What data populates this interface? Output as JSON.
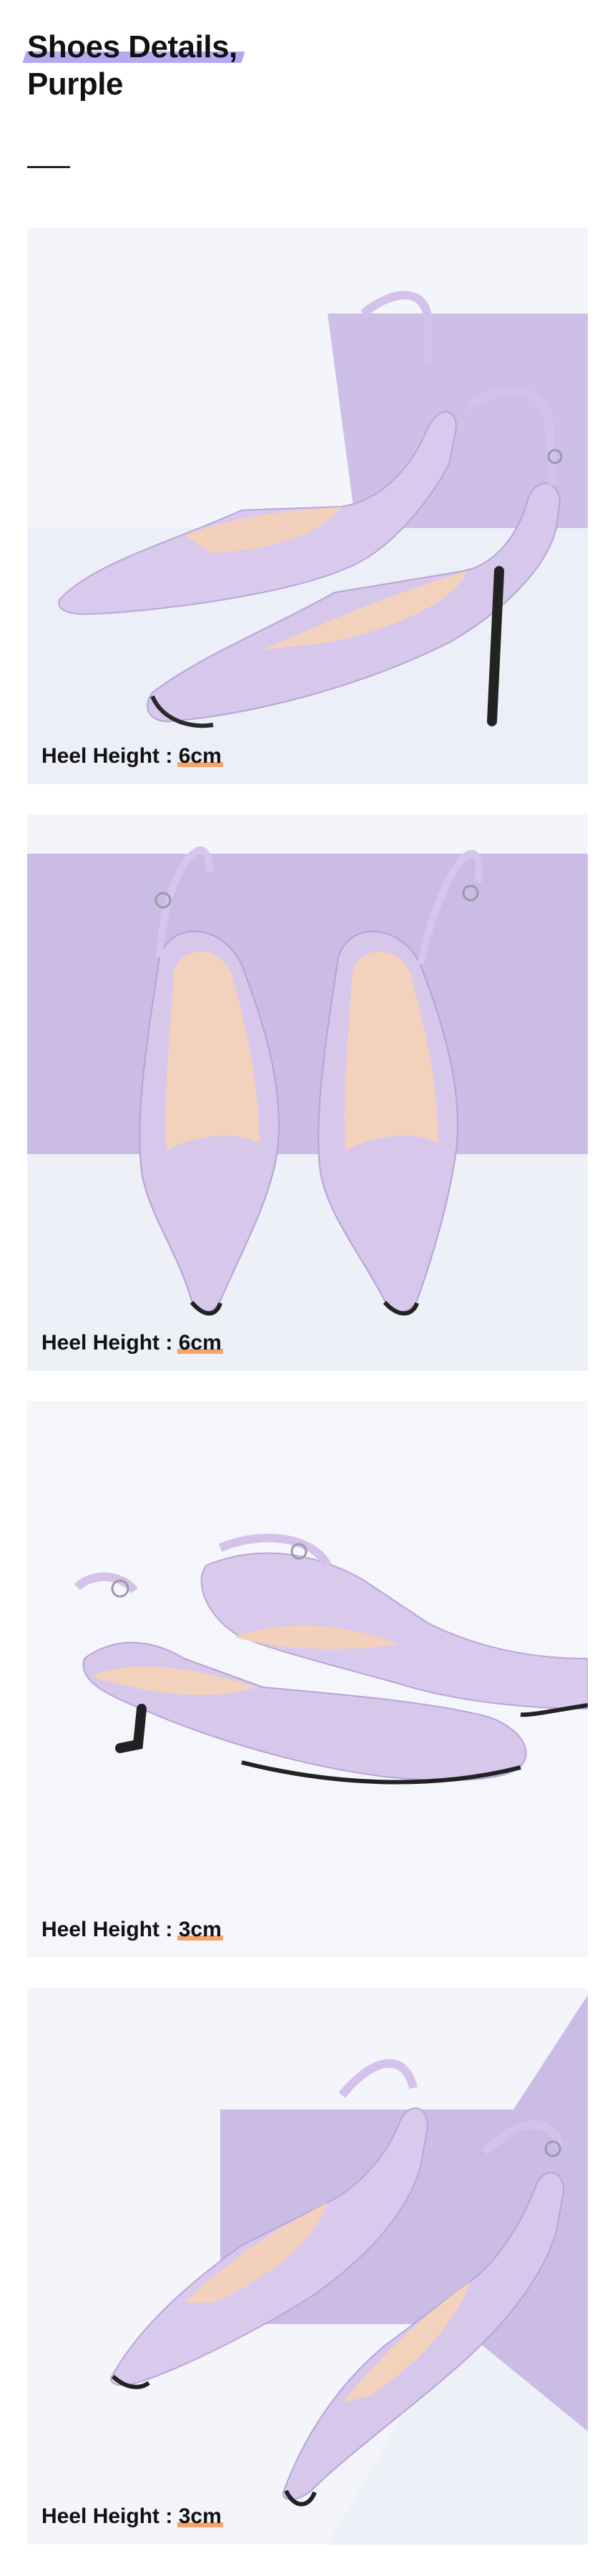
{
  "header": {
    "title_line1": "Shoes Details,",
    "title_line2": "Purple",
    "accent_color": "#b7a8f2"
  },
  "photos": [
    {
      "caption_label": "Heel Height :",
      "caption_value": "6cm",
      "icon": "shoe-photo-side-pair"
    },
    {
      "caption_label": "Heel Height :",
      "caption_value": "6cm",
      "icon": "shoe-photo-front-pair"
    },
    {
      "caption_label": "Heel Height :",
      "caption_value": "3cm",
      "icon": "shoe-photo-side-low"
    },
    {
      "caption_label": "Heel Height :",
      "caption_value": "3cm",
      "icon": "shoe-photo-angled-low"
    }
  ],
  "colors": {
    "shoe": "#d7c7ea",
    "lining": "#f3d2bd",
    "backdrop": "#cbbce6",
    "card_bg": "#f3f5fb",
    "underline": "#f4a46a"
  }
}
